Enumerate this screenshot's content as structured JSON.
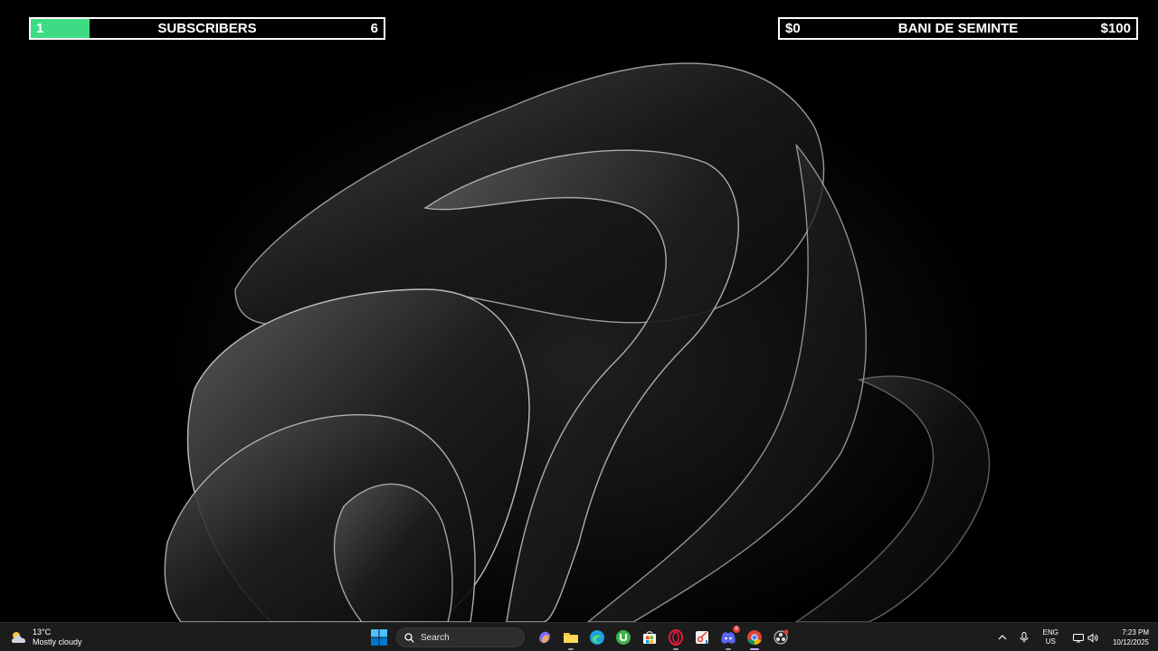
{
  "goals": {
    "subscribers": {
      "current": "1",
      "label": "SUBSCRIBERS",
      "target": "6",
      "progress": 0.1667,
      "fill_color": "#3ddc84"
    },
    "money": {
      "current": "$0",
      "label": "BANI DE SEMINTE",
      "target": "$100",
      "progress": 0.0
    }
  },
  "taskbar": {
    "weather": {
      "temp": "13°C",
      "condition": "Mostly cloudy"
    },
    "search_placeholder": "Search",
    "apps": [
      "start",
      "search",
      "copilot",
      "file-explorer",
      "edge",
      "utorrent",
      "microsoft-store",
      "opera-gx",
      "snipping-tool",
      "discord",
      "chrome",
      "obs"
    ],
    "discord_badge": "8",
    "tray": {
      "lang_top": "ENG",
      "lang_bottom": "US",
      "time": "7:23 PM",
      "date": "10/12/2025"
    }
  }
}
